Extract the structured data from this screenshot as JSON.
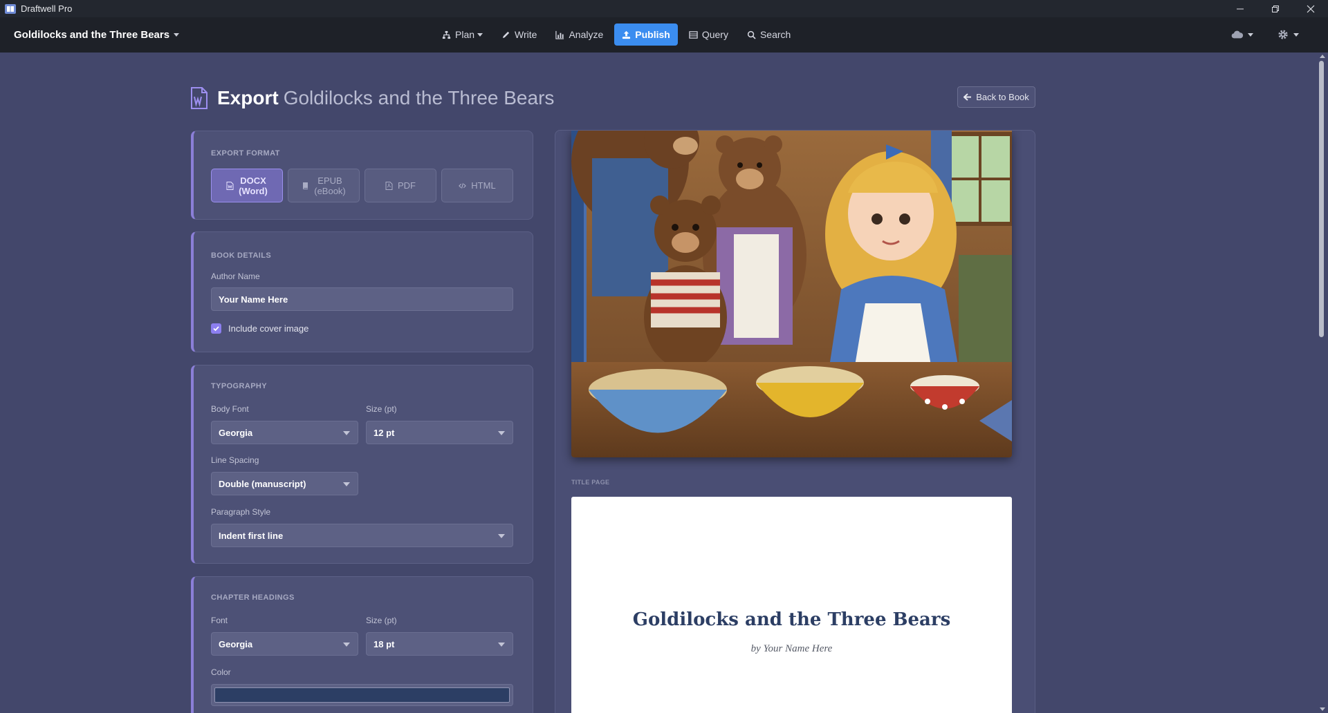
{
  "window": {
    "app_title": "Draftwell Pro"
  },
  "navbar": {
    "book_title": "Goldilocks and the Three Bears",
    "items": [
      {
        "label": "Plan",
        "icon": "sitemap-icon",
        "dropdown": true
      },
      {
        "label": "Write",
        "icon": "pencil-icon"
      },
      {
        "label": "Analyze",
        "icon": "chart-icon"
      },
      {
        "label": "Publish",
        "icon": "upload-icon",
        "active": true
      },
      {
        "label": "Query",
        "icon": "table-icon"
      },
      {
        "label": "Search",
        "icon": "search-icon"
      }
    ],
    "right_icons": [
      "cloud-icon",
      "gear-icon"
    ]
  },
  "page": {
    "heading_strong": "Export",
    "heading_book": "Goldilocks and the Three Bears",
    "back_label": "Back to Book"
  },
  "export_format": {
    "heading": "EXPORT FORMAT",
    "options": [
      {
        "line1": "DOCX",
        "line2": "(Word)",
        "active": true
      },
      {
        "line1": "EPUB",
        "line2": "(eBook)",
        "active": false
      },
      {
        "line1": "PDF",
        "line2": "",
        "active": false
      },
      {
        "line1": "HTML",
        "line2": "",
        "active": false
      }
    ]
  },
  "book_details": {
    "heading": "BOOK DETAILS",
    "author_label": "Author Name",
    "author_value": "Your Name Here",
    "cover_checkbox_label": "Include cover image",
    "cover_checked": true
  },
  "typography": {
    "heading": "TYPOGRAPHY",
    "body_font_label": "Body Font",
    "body_font_value": "Georgia",
    "size_label": "Size (pt)",
    "size_value": "12 pt",
    "line_spacing_label": "Line Spacing",
    "line_spacing_value": "Double (manuscript)",
    "paragraph_label": "Paragraph Style",
    "paragraph_value": "Indent first line"
  },
  "chapter_headings": {
    "heading": "CHAPTER HEADINGS",
    "font_label": "Font",
    "font_value": "Georgia",
    "size_label": "Size (pt)",
    "size_value": "18 pt",
    "color_label": "Color",
    "color_value": "#2c3e64"
  },
  "preview": {
    "title_page_label": "TITLE PAGE",
    "title": "Goldilocks and the Three Bears",
    "byline": "by Your Name Here"
  },
  "colors": {
    "accent": "#3b8df0",
    "panel_border": "#8b7fd8",
    "background": "#43476b"
  }
}
